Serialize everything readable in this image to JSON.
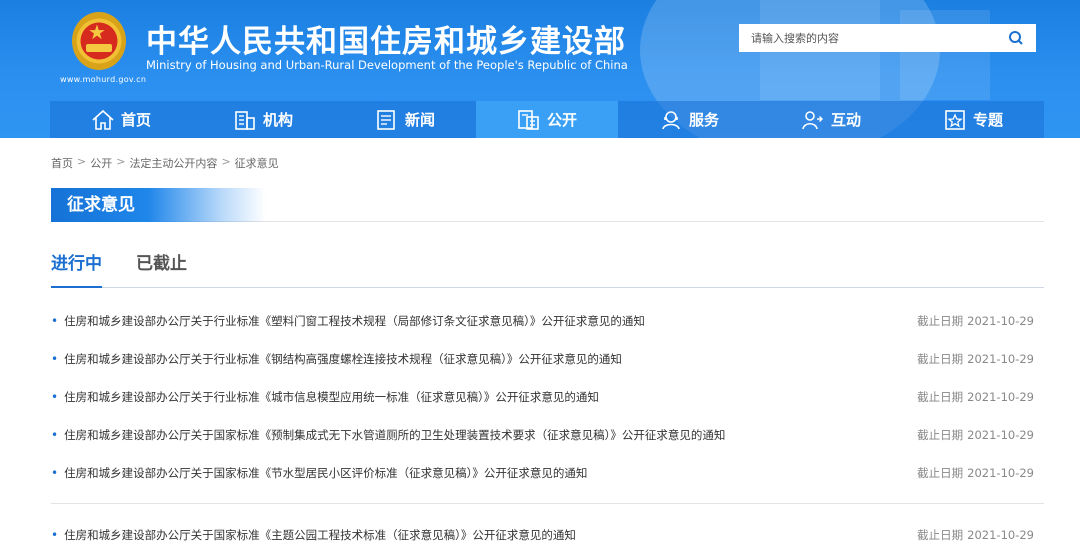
{
  "header": {
    "title": "中华人民共和国住房和城乡建设部",
    "subtitle": "Ministry of Housing and Urban-Rural Development of the People's Republic of China",
    "url": "www.mohurd.gov.cn",
    "search_placeholder": "请输入搜索的内容"
  },
  "nav": [
    {
      "label": "首页",
      "icon": "home-icon"
    },
    {
      "label": "机构",
      "icon": "building-icon"
    },
    {
      "label": "新闻",
      "icon": "news-icon"
    },
    {
      "label": "公开",
      "icon": "document-icon",
      "active": true
    },
    {
      "label": "服务",
      "icon": "service-icon"
    },
    {
      "label": "互动",
      "icon": "interaction-icon"
    },
    {
      "label": "专题",
      "icon": "star-icon"
    }
  ],
  "breadcrumb": [
    "首页",
    "公开",
    "法定主动公开内容",
    "征求意见"
  ],
  "section_title": "征求意见",
  "tabs": [
    {
      "label": "进行中",
      "active": true
    },
    {
      "label": "已截止"
    }
  ],
  "date_label": "截止日期",
  "items": [
    {
      "title": "住房和城乡建设部办公厅关于行业标准《塑料门窗工程技术规程（局部修订条文征求意见稿）》公开征求意见的通知",
      "date": "2021-10-29"
    },
    {
      "title": "住房和城乡建设部办公厅关于行业标准《钢结构高强度螺栓连接技术规程（征求意见稿）》公开征求意见的通知",
      "date": "2021-10-29"
    },
    {
      "title": "住房和城乡建设部办公厅关于行业标准《城市信息模型应用统一标准（征求意见稿）》公开征求意见的通知",
      "date": "2021-10-29"
    },
    {
      "title": "住房和城乡建设部办公厅关于国家标准《预制集成式无下水管道厕所的卫生处理装置技术要求（征求意见稿）》公开征求意见的通知",
      "date": "2021-10-29"
    },
    {
      "title": "住房和城乡建设部办公厅关于国家标准《节水型居民小区评价标准（征求意见稿）》公开征求意见的通知",
      "date": "2021-10-29"
    }
  ],
  "items_after": [
    {
      "title": "住房和城乡建设部办公厅关于国家标准《主题公园工程技术标准（征求意见稿）》公开征求意见的通知",
      "date": "2021-10-29"
    }
  ],
  "colors": {
    "primary": "#1a6fd0",
    "header_bg": "#2b8ff0",
    "nav_active": "#3aa0f5"
  }
}
